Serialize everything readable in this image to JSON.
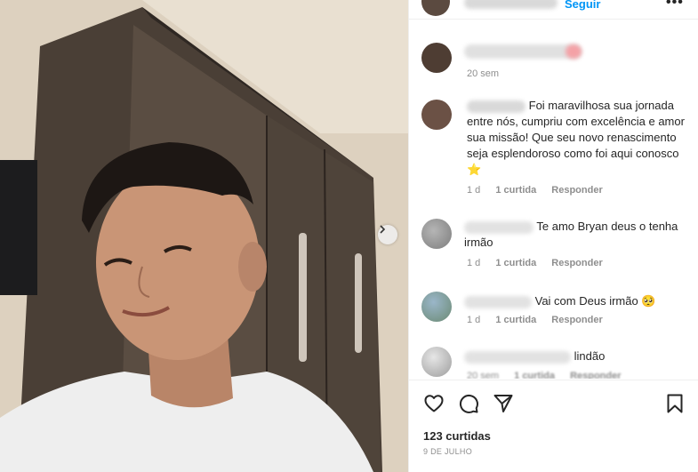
{
  "post": {
    "header": {
      "follow_label": "Seguir",
      "more_label": "•••"
    },
    "comments": [
      {
        "time": "20 sem",
        "text": "",
        "likes": "",
        "reply": ""
      },
      {
        "text": "Foi maravilhosa sua jornada entre nós, cumpriu com excelência e amor sua missão! Que seu novo renascimento seja esplendoroso como foi aqui conosco ⭐",
        "time": "1 d",
        "likes": "1 curtida",
        "reply": "Responder"
      },
      {
        "text": "Te amo Bryan deus o tenha irmão",
        "time": "1 d",
        "likes": "1 curtida",
        "reply": "Responder"
      },
      {
        "text": "Vai com Deus irmão 🥺",
        "time": "1 d",
        "likes": "1 curtida",
        "reply": "Responder"
      },
      {
        "text": "lindão",
        "time": "20 sem",
        "likes": "1 curtida",
        "reply": "Responder"
      }
    ],
    "likes_count": "123 curtidas",
    "date": "9 DE JULHO",
    "icons": [
      "heart-icon",
      "comment-icon",
      "share-icon",
      "bookmark-icon",
      "chevron-right-icon",
      "more-icon"
    ],
    "colors": {
      "accent": "#0095f6",
      "text": "#262626",
      "muted": "#8e8e8e"
    }
  }
}
